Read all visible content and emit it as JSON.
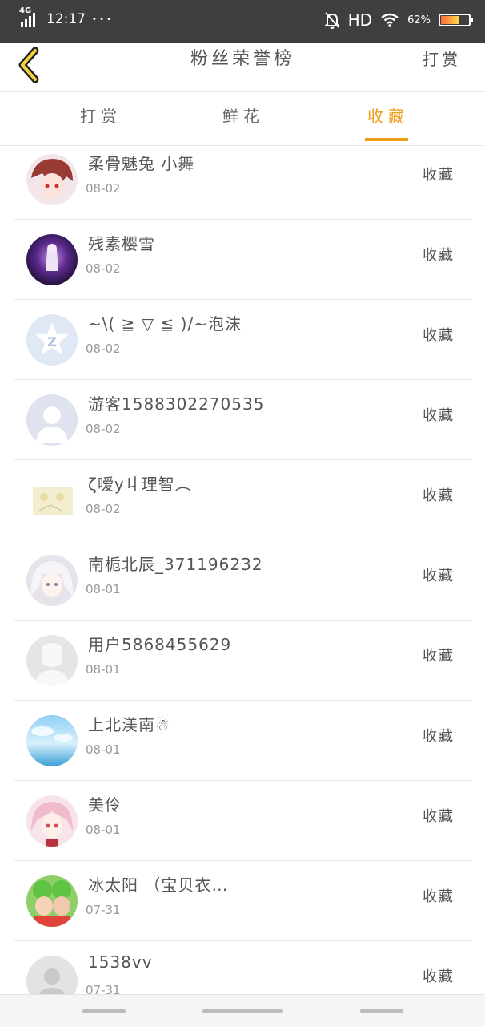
{
  "status_bar": {
    "network": "4G",
    "time": "12:17",
    "dots": "• • •",
    "hd": "HD",
    "battery_percent": "62%",
    "battery_level": 0.62
  },
  "header": {
    "back_icon": "chevron-left-icon",
    "title": "粉丝荣誉榜",
    "action": "打赏"
  },
  "tabs": [
    {
      "label": "打赏",
      "active": false
    },
    {
      "label": "鲜花",
      "active": false
    },
    {
      "label": "收藏",
      "active": true
    }
  ],
  "accent_color": "#ee9d17",
  "rows": [
    {
      "name": "柔骨魅兔 小舞",
      "date": "08-02",
      "action": "收藏"
    },
    {
      "name": "残素樱雪",
      "date": "08-02",
      "action": "收藏"
    },
    {
      "name": "~\\( ≧ ▽ ≦ )/~泡沫",
      "date": "08-02",
      "action": "收藏"
    },
    {
      "name": "游客1588302270535",
      "date": "08-02",
      "action": "收藏"
    },
    {
      "name": "ζ嗳у丩理智︵",
      "date": "08-02",
      "action": "收藏"
    },
    {
      "name": "南栀北辰_371196232",
      "date": "08-01",
      "action": "收藏"
    },
    {
      "name": "用户5868455629",
      "date": "08-01",
      "action": "收藏"
    },
    {
      "name": "上北渼南☃",
      "date": "08-01",
      "action": "收藏"
    },
    {
      "name": "美伶",
      "date": "08-01",
      "action": "收藏"
    },
    {
      "name": "冰太阳 （宝贝衣…",
      "date": "07-31",
      "action": "收藏"
    },
    {
      "name": "1538vv",
      "date": "07-31",
      "action": "收藏"
    }
  ]
}
